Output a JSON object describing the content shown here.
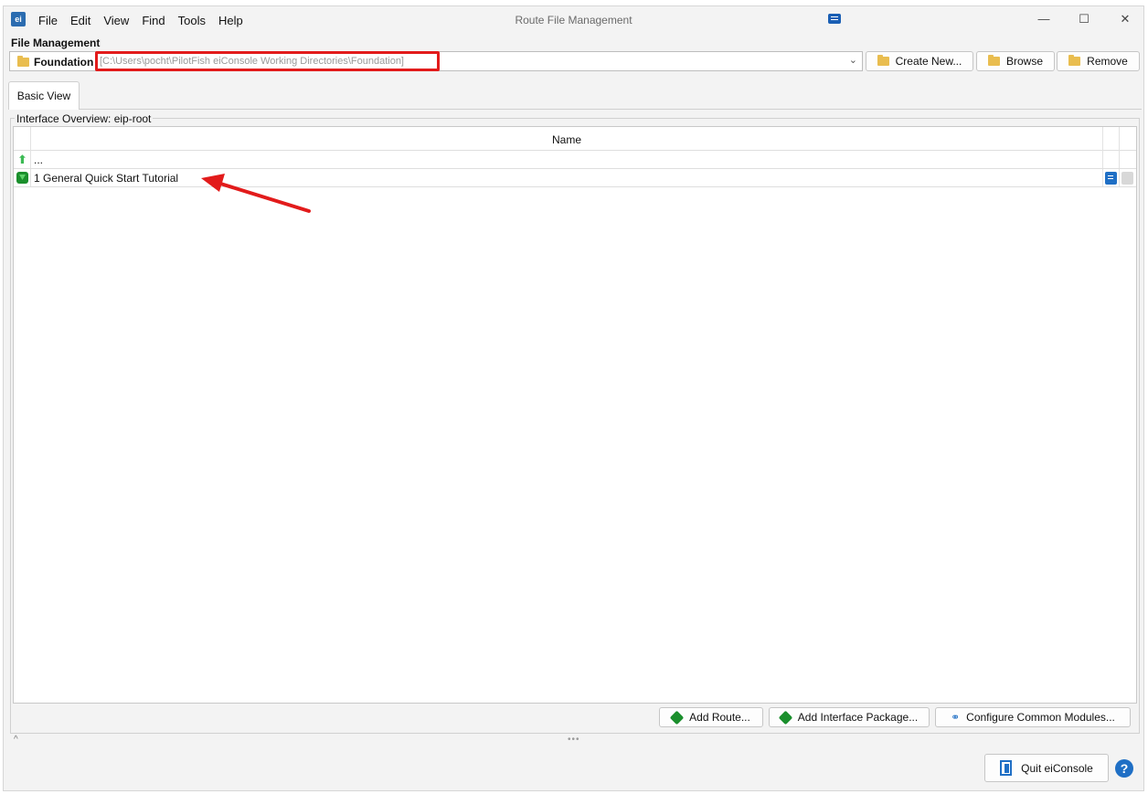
{
  "app": {
    "window_title": "Route File Management",
    "icon_text": "ei"
  },
  "menu": [
    "File",
    "Edit",
    "View",
    "Find",
    "Tools",
    "Help"
  ],
  "window_controls": {
    "minimize": "—",
    "maximize": "☐",
    "close": "✕"
  },
  "file_management": {
    "section_label": "File Management",
    "working_dir_name": "Foundation",
    "working_dir_path": "[C:\\Users\\pocht\\PilotFish eiConsole Working Directories\\Foundation]",
    "buttons": {
      "create_new": "Create New...",
      "browse": "Browse",
      "remove": "Remove"
    }
  },
  "tabs": [
    {
      "label": "Basic View",
      "active": true
    }
  ],
  "overview": {
    "title": "Interface Overview: eip-root",
    "column_header": "Name",
    "rows": [
      {
        "icon": "up-arrow-icon",
        "label": "..."
      },
      {
        "icon": "package-icon",
        "label": "1 General Quick Start Tutorial"
      }
    ]
  },
  "actions": {
    "add_route": "Add Route...",
    "add_interface_package": "Add Interface Package...",
    "configure_common_modules": "Configure Common Modules..."
  },
  "footer": {
    "quit": "Quit eiConsole",
    "help": "?",
    "collapse": "^",
    "splitter": "•••"
  },
  "colors": {
    "highlight": "#e21b1b",
    "accent": "#1f6fc5",
    "package_green": "#1b8f2d",
    "folder": "#e9bd4f"
  }
}
